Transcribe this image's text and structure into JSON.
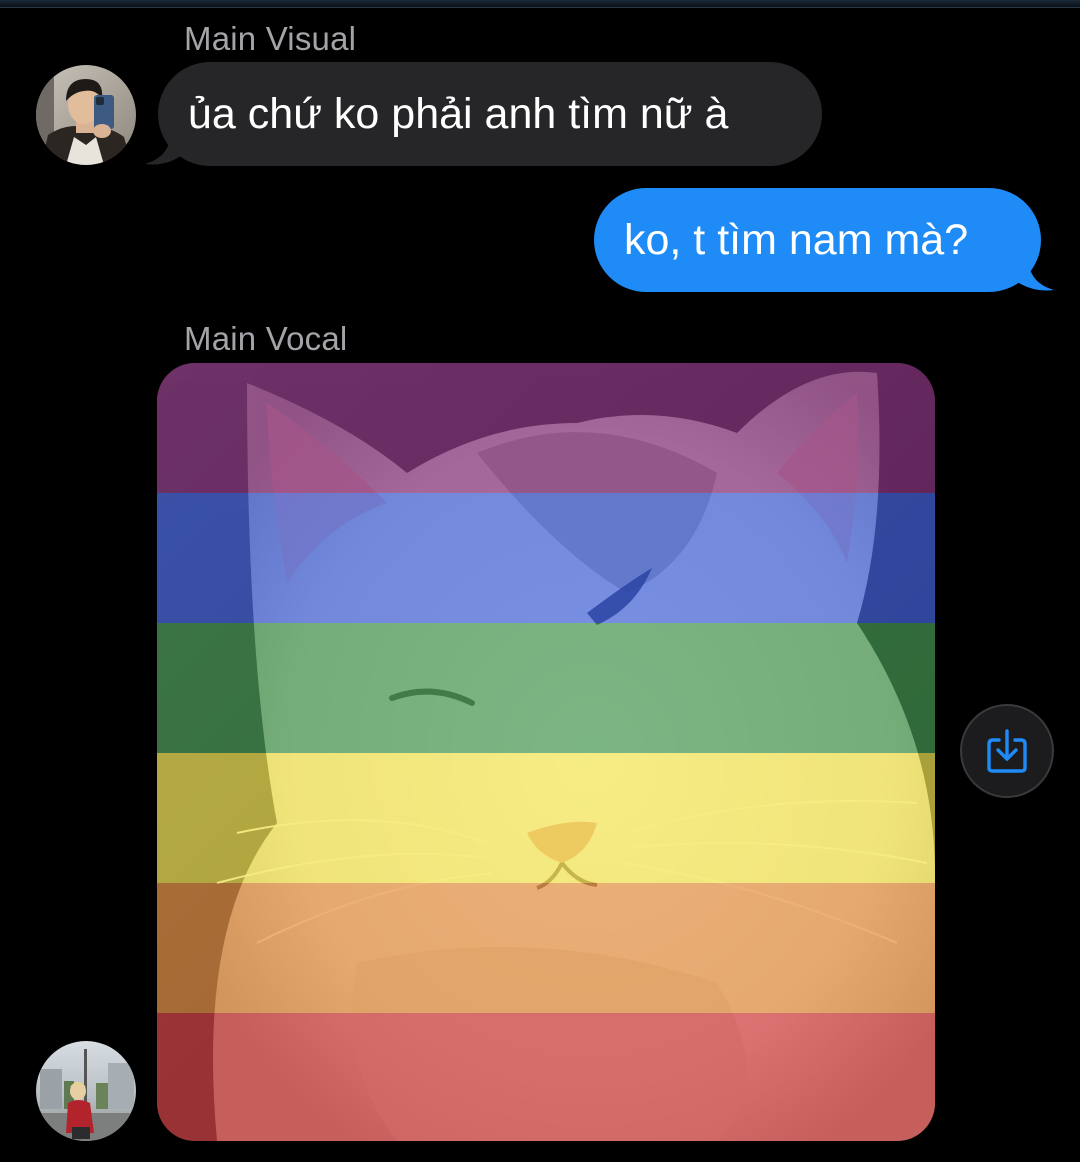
{
  "conversation": {
    "messages": [
      {
        "sender": "Main Visual",
        "direction": "incoming",
        "text": "ủa chứ ko phải anh tìm nữ à"
      },
      {
        "direction": "outgoing",
        "text": "ko, t tìm nam mà?"
      },
      {
        "sender": "Main Vocal",
        "direction": "incoming",
        "attachment": "photo"
      }
    ]
  },
  "icons": {
    "save": "share-download-icon"
  },
  "colors": {
    "background": "#000000",
    "incoming_bubble": "#262629",
    "outgoing_bubble": "#1e8bf6",
    "sender_name": "#a3a3a8",
    "accent": "#1e8bf6",
    "pride_flag": [
      "#7a1a6e",
      "#2a4fd6",
      "#2e8a3a",
      "#f2e23a",
      "#e2842a",
      "#cf2a2a"
    ]
  }
}
